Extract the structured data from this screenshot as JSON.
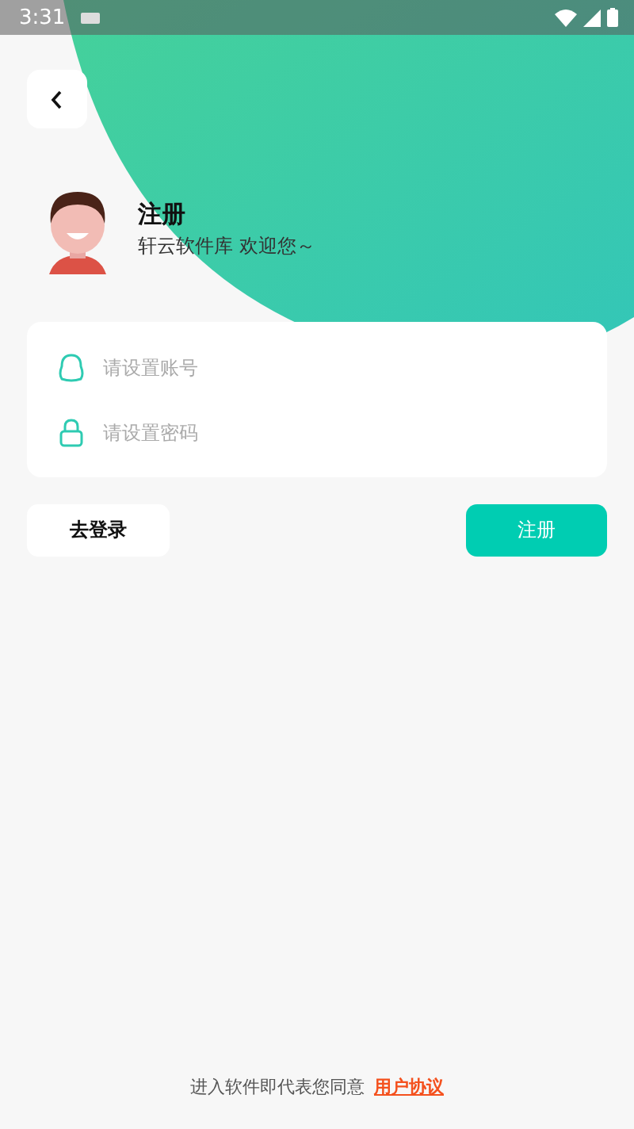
{
  "status_bar": {
    "time": "3:31"
  },
  "header": {
    "title": "注册",
    "subtitle": "轩云软件库 欢迎您～"
  },
  "form": {
    "fields": [
      {
        "kind": "account",
        "placeholder": "请设置账号"
      },
      {
        "kind": "password",
        "placeholder": "请设置密码"
      }
    ]
  },
  "buttons": {
    "login": "去登录",
    "register": "注册"
  },
  "footer": {
    "text": "进入软件即代表您同意",
    "link": "用户协议"
  }
}
